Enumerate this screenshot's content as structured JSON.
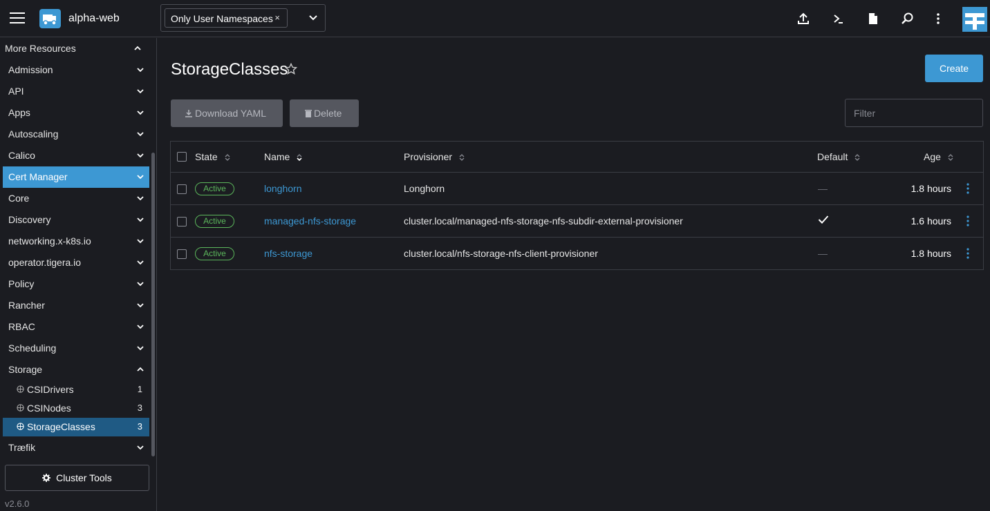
{
  "header": {
    "cluster_name": "alpha-web",
    "namespace_chip": "Only User Namespaces",
    "chip_remove": "×",
    "icons": [
      "import-yaml-icon",
      "kubectl-shell-icon",
      "kubeconfig-file-icon",
      "search-icon",
      "more-vertical-icon"
    ],
    "accent": "#3d98d3"
  },
  "sidebar": {
    "top_group": "More Resources",
    "groups": [
      {
        "label": "Admission"
      },
      {
        "label": "API"
      },
      {
        "label": "Apps"
      },
      {
        "label": "Autoscaling"
      },
      {
        "label": "Calico"
      },
      {
        "label": "Cert Manager",
        "active": true
      },
      {
        "label": "Core"
      },
      {
        "label": "Discovery"
      },
      {
        "label": "networking.x-k8s.io"
      },
      {
        "label": "operator.tigera.io"
      },
      {
        "label": "Policy"
      },
      {
        "label": "Rancher"
      },
      {
        "label": "RBAC"
      },
      {
        "label": "Scheduling"
      },
      {
        "label": "Storage",
        "expanded": true
      }
    ],
    "storage_items": [
      {
        "label": "CSIDrivers",
        "count": "1"
      },
      {
        "label": "CSINodes",
        "count": "3"
      },
      {
        "label": "StorageClasses",
        "count": "3",
        "active": true
      }
    ],
    "last_group": "Træfik",
    "cluster_tools": "Cluster Tools",
    "version": "v2.6.0"
  },
  "main": {
    "title": "StorageClasses",
    "create_label": "Create",
    "download_label": "Download YAML",
    "delete_label": "Delete",
    "filter_placeholder": "Filter",
    "columns": {
      "state": "State",
      "name": "Name",
      "provisioner": "Provisioner",
      "default": "Default",
      "age": "Age"
    },
    "rows": [
      {
        "state": "Active",
        "name": "longhorn",
        "provisioner": "Longhorn",
        "default": "—",
        "age": "1.8 hours"
      },
      {
        "state": "Active",
        "name": "managed-nfs-storage",
        "provisioner": "cluster.local/managed-nfs-storage-nfs-subdir-external-provisioner",
        "default": "check",
        "age": "1.6 hours"
      },
      {
        "state": "Active",
        "name": "nfs-storage",
        "provisioner": "cluster.local/nfs-storage-nfs-client-provisioner",
        "default": "—",
        "age": "1.8 hours"
      }
    ]
  }
}
